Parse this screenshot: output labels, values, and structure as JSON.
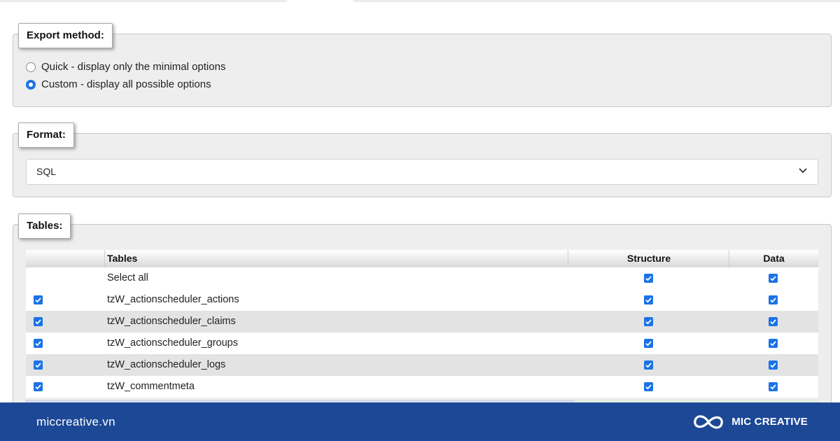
{
  "export_method": {
    "legend": "Export method:",
    "options": [
      {
        "label": "Quick - display only the minimal options",
        "selected": false
      },
      {
        "label": "Custom - display all possible options",
        "selected": true
      }
    ]
  },
  "format": {
    "legend": "Format:",
    "selected": "SQL"
  },
  "tables": {
    "legend": "Tables:",
    "headers": {
      "tables": "Tables",
      "structure": "Structure",
      "data": "Data"
    },
    "select_all": "Select all",
    "rows": [
      {
        "name": "tzW_actionscheduler_actions",
        "checked": true,
        "structure": true,
        "data": true
      },
      {
        "name": "tzW_actionscheduler_claims",
        "checked": true,
        "structure": true,
        "data": true
      },
      {
        "name": "tzW_actionscheduler_groups",
        "checked": true,
        "structure": true,
        "data": true
      },
      {
        "name": "tzW_actionscheduler_logs",
        "checked": true,
        "structure": true,
        "data": true
      },
      {
        "name": "tzW_commentmeta",
        "checked": true,
        "structure": true,
        "data": true
      }
    ]
  },
  "footer": {
    "url": "miccreative.vn",
    "brand": "MIC CREATIVE"
  },
  "colors": {
    "accent": "#1a73e8",
    "footer_bg": "#1d4896"
  }
}
